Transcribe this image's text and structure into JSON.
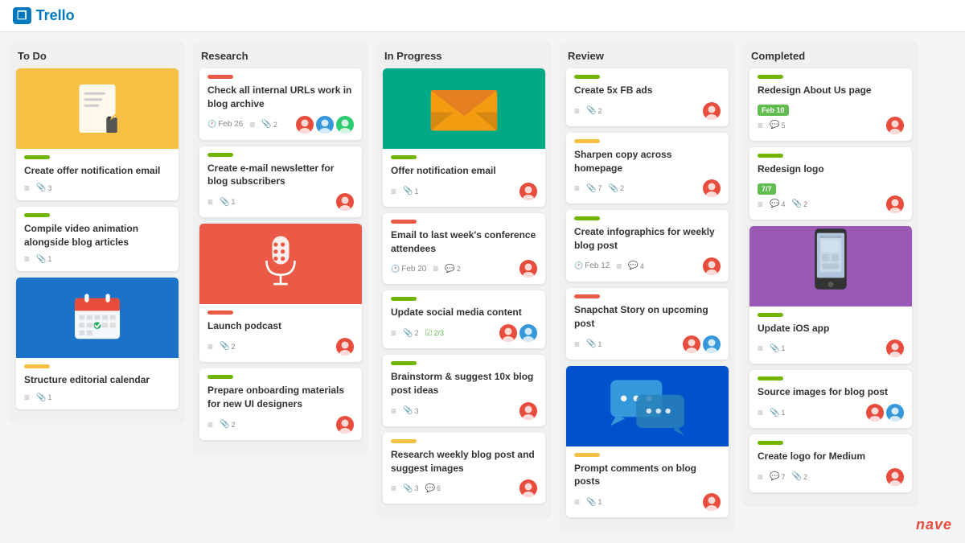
{
  "header": {
    "logo_text": "Trello",
    "logo_box": "≡"
  },
  "columns": [
    {
      "id": "todo",
      "title": "To Do",
      "cards": [
        {
          "id": "todo-1",
          "image_type": "checklist",
          "label_color": "green",
          "title": "Create offer notification email",
          "meta": [
            {
              "icon": "≡",
              "value": ""
            },
            {
              "icon": "🔗",
              "value": "3"
            }
          ],
          "avatars": []
        },
        {
          "id": "todo-2",
          "image_type": "none",
          "label_color": "green",
          "title": "Compile video animation alongside blog articles",
          "meta": [
            {
              "icon": "≡",
              "value": ""
            },
            {
              "icon": "🔗",
              "value": "1"
            }
          ],
          "avatars": []
        },
        {
          "id": "todo-3",
          "image_type": "calendar",
          "label_color": "yellow",
          "title": "Structure editorial calendar",
          "meta": [
            {
              "icon": "≡",
              "value": ""
            },
            {
              "icon": "🔗",
              "value": "1"
            }
          ],
          "avatars": []
        }
      ]
    },
    {
      "id": "research",
      "title": "Research",
      "cards": [
        {
          "id": "res-1",
          "image_type": "none",
          "label_color": "orange",
          "title": "Check all internal URLs work in blog archive",
          "date": "Feb 26",
          "meta": [
            {
              "icon": "≡",
              "value": ""
            },
            {
              "icon": "🔗",
              "value": "2"
            }
          ],
          "avatars": [
            "A",
            "B",
            "C"
          ]
        },
        {
          "id": "res-2",
          "image_type": "none",
          "label_color": "green",
          "title": "Create e-mail newsletter for blog subscribers",
          "meta": [
            {
              "icon": "≡",
              "value": ""
            },
            {
              "icon": "🔗",
              "value": "1"
            }
          ],
          "avatars": [
            "D"
          ]
        },
        {
          "id": "res-3",
          "image_type": "mic",
          "label_color": "orange",
          "title": "Launch podcast",
          "meta": [
            {
              "icon": "≡",
              "value": ""
            },
            {
              "icon": "🔗",
              "value": "2"
            }
          ],
          "avatars": [
            "E"
          ]
        },
        {
          "id": "res-4",
          "image_type": "none",
          "label_color": "green",
          "title": "Prepare onboarding materials for new UI designers",
          "meta": [
            {
              "icon": "≡",
              "value": ""
            },
            {
              "icon": "🔗",
              "value": "2"
            }
          ],
          "avatars": [
            "F"
          ]
        }
      ]
    },
    {
      "id": "inprogress",
      "title": "In Progress",
      "cards": [
        {
          "id": "ip-1",
          "image_type": "envelope",
          "label_color": "green",
          "title": "Offer notification email",
          "meta": [
            {
              "icon": "≡",
              "value": ""
            },
            {
              "icon": "🔗",
              "value": "1"
            }
          ],
          "avatars": [
            "G"
          ]
        },
        {
          "id": "ip-2",
          "image_type": "none",
          "label_color": "orange",
          "title": "Email to last week's conference attendees",
          "date": "Feb 20",
          "meta": [
            {
              "icon": "≡",
              "value": ""
            },
            {
              "icon": "💬",
              "value": "2"
            }
          ],
          "avatars": [
            "H"
          ]
        },
        {
          "id": "ip-3",
          "image_type": "none",
          "label_color": "green",
          "title": "Update social media content",
          "meta": [
            {
              "icon": "≡",
              "value": ""
            },
            {
              "icon": "🔗",
              "value": "2"
            },
            {
              "icon": "☑",
              "value": "2/3"
            }
          ],
          "avatars": [
            "I",
            "J"
          ]
        },
        {
          "id": "ip-4",
          "image_type": "none",
          "label_color": "green",
          "title": "Brainstorm & suggest 10x blog post ideas",
          "meta": [
            {
              "icon": "≡",
              "value": ""
            },
            {
              "icon": "🔗",
              "value": "3"
            }
          ],
          "avatars": [
            "K"
          ]
        },
        {
          "id": "ip-5",
          "image_type": "none",
          "label_color": "yellow",
          "title": "Research weekly blog post and suggest images",
          "meta": [
            {
              "icon": "≡",
              "value": ""
            },
            {
              "icon": "🔗",
              "value": "3"
            },
            {
              "icon": "💬",
              "value": "6"
            }
          ],
          "avatars": [
            "L"
          ]
        }
      ]
    },
    {
      "id": "review",
      "title": "Review",
      "cards": [
        {
          "id": "rev-1",
          "image_type": "none",
          "label_color": "green",
          "title": "Create 5x FB ads",
          "meta": [
            {
              "icon": "≡",
              "value": ""
            },
            {
              "icon": "🔗",
              "value": "2"
            }
          ],
          "avatars": [
            "M"
          ]
        },
        {
          "id": "rev-2",
          "image_type": "none",
          "label_color": "yellow",
          "title": "Sharpen copy across homepage",
          "meta": [
            {
              "icon": "≡",
              "value": ""
            },
            {
              "icon": "🔗",
              "value": "7"
            },
            {
              "icon": "🔗",
              "value": "2"
            }
          ],
          "avatars": [
            "N"
          ]
        },
        {
          "id": "rev-3",
          "image_type": "none",
          "label_color": "green",
          "title": "Create infographics for weekly blog post",
          "date": "Feb 12",
          "meta": [
            {
              "icon": "≡",
              "value": ""
            },
            {
              "icon": "💬",
              "value": "4"
            }
          ],
          "avatars": [
            "O"
          ]
        },
        {
          "id": "rev-4",
          "image_type": "none",
          "label_color": "orange",
          "title": "Snapchat Story on upcoming post",
          "meta": [
            {
              "icon": "≡",
              "value": ""
            },
            {
              "icon": "🔗",
              "value": "1"
            }
          ],
          "avatars": [
            "P",
            "Q"
          ]
        },
        {
          "id": "rev-5",
          "image_type": "chat",
          "label_color": "yellow",
          "title": "Prompt comments on blog posts",
          "meta": [
            {
              "icon": "≡",
              "value": ""
            },
            {
              "icon": "🔗",
              "value": "1"
            }
          ],
          "avatars": [
            "R"
          ]
        }
      ]
    },
    {
      "id": "completed",
      "title": "Completed",
      "cards": [
        {
          "id": "comp-1",
          "image_type": "none",
          "label_color": "green",
          "title": "Redesign About Us page",
          "date_badge": "Feb 10",
          "meta": [
            {
              "icon": "≡",
              "value": ""
            },
            {
              "icon": "💬",
              "value": "5"
            }
          ],
          "avatars": [
            "S"
          ]
        },
        {
          "id": "comp-2",
          "image_type": "none",
          "label_color": "green",
          "title": "Redesign logo",
          "progress": "7/7",
          "meta": [
            {
              "icon": "≡",
              "value": ""
            },
            {
              "icon": "💬",
              "value": "4"
            },
            {
              "icon": "🔗",
              "value": "2"
            }
          ],
          "avatars": [
            "T"
          ]
        },
        {
          "id": "comp-3",
          "image_type": "phone",
          "label_color": "green",
          "title": "Update iOS app",
          "meta": [
            {
              "icon": "≡",
              "value": ""
            },
            {
              "icon": "🔗",
              "value": "1"
            }
          ],
          "avatars": [
            "U"
          ]
        },
        {
          "id": "comp-4",
          "image_type": "none",
          "label_color": "green",
          "title": "Source images for blog post",
          "meta": [
            {
              "icon": "≡",
              "value": ""
            },
            {
              "icon": "🔗",
              "value": "1"
            }
          ],
          "avatars": [
            "V",
            "W"
          ]
        },
        {
          "id": "comp-5",
          "image_type": "none",
          "label_color": "green",
          "title": "Create logo for Medium",
          "meta": [
            {
              "icon": "≡",
              "value": ""
            },
            {
              "icon": "💬",
              "value": "7"
            },
            {
              "icon": "🔗",
              "value": "2"
            }
          ],
          "avatars": [
            "X"
          ]
        }
      ]
    }
  ],
  "nave": "nave"
}
